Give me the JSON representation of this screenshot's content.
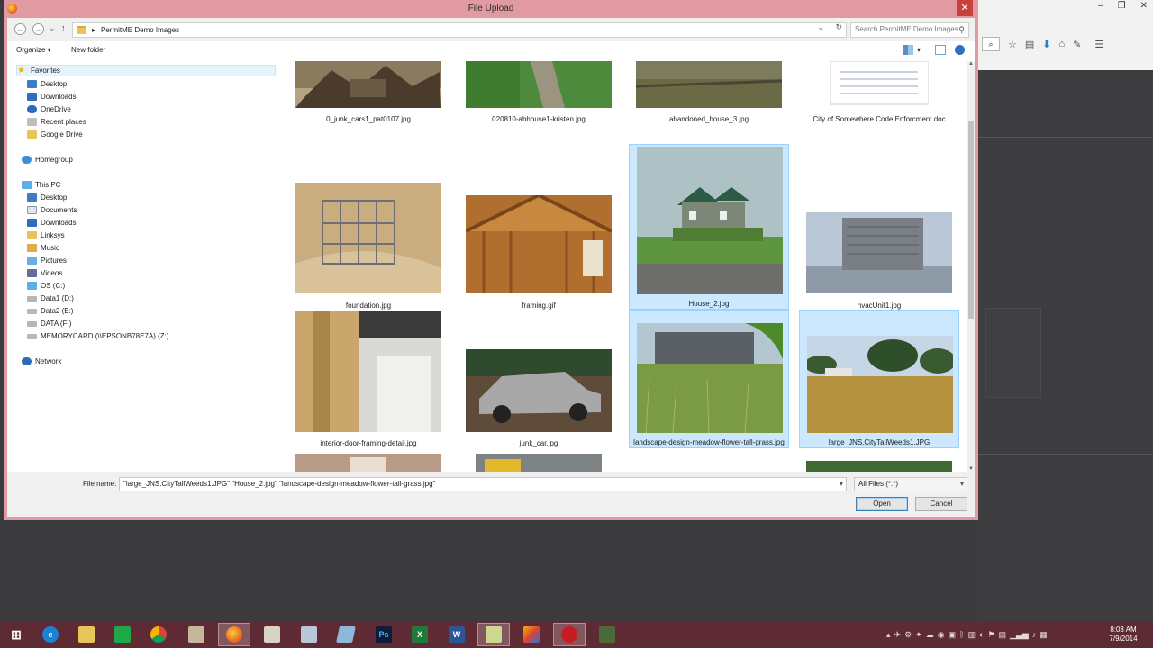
{
  "dialog": {
    "title": "File Upload",
    "close_glyph": "✕"
  },
  "address": {
    "path_sep": "▸",
    "folder": "PermitME Demo Images",
    "search_placeholder": "Search PermitME Demo Images"
  },
  "commands": {
    "organize": "Organize ▾",
    "new_folder": "New folder"
  },
  "nav": {
    "favorites": "Favorites",
    "fav_items": [
      "Desktop",
      "Downloads",
      "OneDrive",
      "Recent places",
      "Google Drive"
    ],
    "homegroup": "Homegroup",
    "this_pc": "This PC",
    "pc_items": [
      "Desktop",
      "Documents",
      "Downloads",
      "Linksys",
      "Music",
      "Pictures",
      "Videos",
      "OS (C:)",
      "Data1 (D:)",
      "Data2 (E:)",
      "DATA (F:)",
      "MEMORYCARD (\\\\EPSONB78E7A) (Z:)"
    ],
    "network": "Network"
  },
  "files": [
    {
      "name": "0_junk_cars1_pat0107.jpg",
      "selected": false
    },
    {
      "name": "020810-abhouse1-kristen.jpg",
      "selected": false
    },
    {
      "name": "abandoned_house_3.jpg",
      "selected": false
    },
    {
      "name": "City of Somewhere Code Enforcment.doc",
      "selected": false
    },
    {
      "name": "foundation.jpg",
      "selected": false
    },
    {
      "name": "framing.gif",
      "selected": false
    },
    {
      "name": "House_2.jpg",
      "selected": true
    },
    {
      "name": "hvacUnit1.jpg",
      "selected": false
    },
    {
      "name": "interior-door-framing-detail.jpg",
      "selected": false
    },
    {
      "name": "junk_car.jpg",
      "selected": false
    },
    {
      "name": "landscape-design-meadow-flower-tall-grass.jpg",
      "selected": true
    },
    {
      "name": "large_JNS.CityTallWeeds1.JPG",
      "selected": true
    }
  ],
  "bottom": {
    "file_name_label": "File name:",
    "file_name_value": "\"large_JNS.CityTallWeeds1.JPG\" \"House_2.jpg\" \"landscape-design-meadow-flower-tall-grass.jpg\"",
    "filter": "All Files (*.*)",
    "open": "Open",
    "cancel": "Cancel"
  },
  "taskbar": {
    "time": "8:03 AM",
    "date": "7/9/2014"
  },
  "colors": {
    "dialog_frame": "#e19aa1",
    "taskbar": "#5e2a33",
    "selection": "#cce8ff"
  }
}
